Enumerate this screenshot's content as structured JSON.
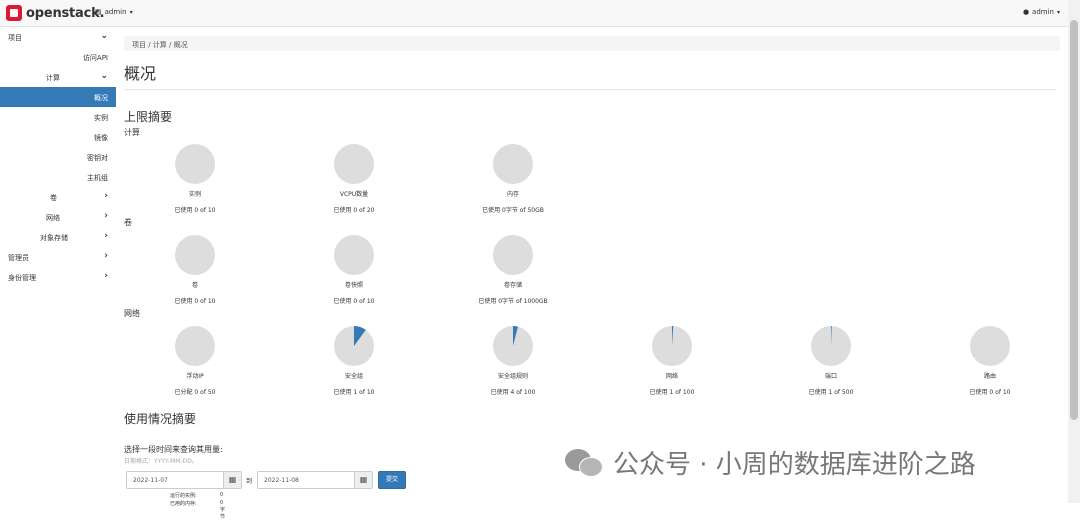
{
  "header": {
    "logo_text": "openstack.",
    "project_menu": "admin",
    "user_menu": "admin",
    "caret": "▾"
  },
  "sidebar": {
    "items": [
      {
        "label": "项目",
        "chevron": "⌄"
      },
      {
        "label": "访问API",
        "chevron": ""
      },
      {
        "label": "计算",
        "chevron": "⌄"
      },
      {
        "label": "概况",
        "chevron": ""
      },
      {
        "label": "实例",
        "chevron": ""
      },
      {
        "label": "镜像",
        "chevron": ""
      },
      {
        "label": "密钥对",
        "chevron": ""
      },
      {
        "label": "主机组",
        "chevron": ""
      },
      {
        "label": "卷",
        "chevron": "›"
      },
      {
        "label": "网络",
        "chevron": "›"
      },
      {
        "label": "对象存储",
        "chevron": "›"
      },
      {
        "label": "管理员",
        "chevron": "›"
      },
      {
        "label": "身份管理",
        "chevron": "›"
      }
    ]
  },
  "breadcrumb": "项目 / 计算 / 概况",
  "page_title": "概况",
  "limit_summary_title": "上限摘要",
  "groups": {
    "compute": "计算",
    "volume": "卷",
    "network": "网络"
  },
  "pies": {
    "compute": [
      {
        "label": "实例",
        "usage": "已使用 0 of 10",
        "fraction": 0
      },
      {
        "label": "VCPU数量",
        "usage": "已使用 0 of 20",
        "fraction": 0
      },
      {
        "label": "内存",
        "usage": "已使用 0字节 of 50GB",
        "fraction": 0
      }
    ],
    "volume": [
      {
        "label": "卷",
        "usage": "已使用 0 of 10",
        "fraction": 0
      },
      {
        "label": "卷快照",
        "usage": "已使用 0 of 10",
        "fraction": 0
      },
      {
        "label": "卷存储",
        "usage": "已使用 0字节 of 1000GB",
        "fraction": 0
      }
    ],
    "network": [
      {
        "label": "浮动IP",
        "usage": "已分配 0 of 50",
        "fraction": 0
      },
      {
        "label": "安全组",
        "usage": "已使用 1 of 10",
        "fraction": 0.1
      },
      {
        "label": "安全组规则",
        "usage": "已使用 4 of 100",
        "fraction": 0.04
      },
      {
        "label": "网络",
        "usage": "已使用 1 of 100",
        "fraction": 0.01
      },
      {
        "label": "端口",
        "usage": "已使用 1 of 500",
        "fraction": 0.002
      },
      {
        "label": "路由",
        "usage": "已使用 0 of 10",
        "fraction": 0
      }
    ]
  },
  "usage_summary_title": "使用情况摘要",
  "usage_prompt": "选择一段时间来查询其用量:",
  "date_hint": "日期格式：YYYY-MM-DD。",
  "start_date": "2022-11-07",
  "to_label": "到",
  "end_date": "2022-11-08",
  "submit_label": "提交",
  "stats": [
    {
      "label": "运行的实例:",
      "value": "0"
    },
    {
      "label": "已用的内存:",
      "value": "0字节"
    }
  ],
  "watermark_text": "公众号 · 小周的数据库进阶之路",
  "colors": {
    "accent": "#337ab7",
    "pie_bg": "#dddddd",
    "pie_fill": "#337ab7",
    "logo_red": "#da1a32"
  },
  "icons": {
    "calendar": "▦"
  }
}
